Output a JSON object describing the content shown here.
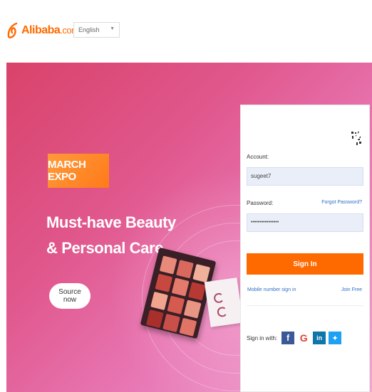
{
  "header": {
    "logo_text": "Alibaba",
    "logo_suffix": ".com",
    "language": "English"
  },
  "banner": {
    "badge": "MARCH EXPO",
    "headline_line1": "Must-have  Beauty",
    "headline_line2": "& Personal Care",
    "cta": "Source now"
  },
  "login": {
    "account_label": "Account:",
    "account_value": "sugeet7",
    "password_label": "Password:",
    "password_value": "••••••••••••••••",
    "forgot": "Forgot Password?",
    "signin": "Sign In",
    "mobile_signin": "Mobile number sign in",
    "join": "Join Free",
    "social_label": "Sign in with:"
  },
  "colors": {
    "brand": "#ff6a00",
    "link": "#2f6fc4",
    "input_bg": "#e9eef8"
  },
  "icons": {
    "logo": "alibaba-logo-icon",
    "dropdown": "chevron-down-icon",
    "qr": "qr-code-icon",
    "facebook": "facebook-icon",
    "google": "google-icon",
    "linkedin": "linkedin-icon",
    "twitter": "twitter-icon"
  }
}
